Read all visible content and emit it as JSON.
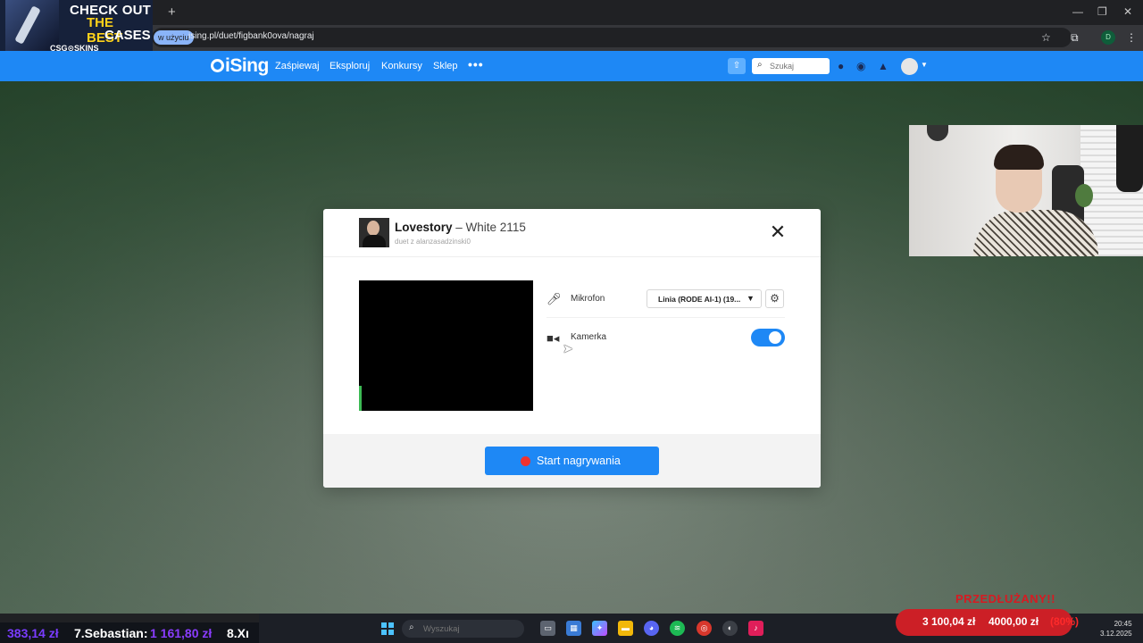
{
  "promo": {
    "line1": "CHECK OUT",
    "line2": "THE BEST",
    "line3": "CASES",
    "brand": "CSG⊙SKINS"
  },
  "browser": {
    "new_tab_icon": "+",
    "url_chip": "w użyciu",
    "url": "ising.pl/duet/figbank0ova/nagraj",
    "profile_initial": "D"
  },
  "nav": {
    "logo": "iSing",
    "links": [
      "Zaśpiewaj",
      "Eksploruj",
      "Konkursy",
      "Sklep"
    ],
    "search_placeholder": "Szukaj"
  },
  "modal": {
    "song": "Lovestory",
    "artist": " – White 2115",
    "subtitle": "duet z alanzasadzinski0",
    "mic_label": "Mikrofon",
    "mic_value": "Linia (RODE AI-1) (19...",
    "camera_label": "Kamerka",
    "camera_on": true,
    "record_button": "Start nagrywania"
  },
  "ticker": {
    "amount1": "383,14 zł",
    "name2": "7.Sebastian:",
    "amount2": "1 161,80 zł",
    "name3": "8.Xı"
  },
  "taskbar": {
    "search_placeholder": "Wyszukaj",
    "clock": "20:45",
    "date": "3.12.2025"
  },
  "goal": {
    "title": "PRZEDŁUŻANY!!",
    "current": "3 100,04 zł",
    "target": "4000,00 zł",
    "percent": "(80%)"
  },
  "colors": {
    "nav_blue": "#1e88f5",
    "record_red": "#f0322f",
    "goal_red": "#cc1f26"
  }
}
